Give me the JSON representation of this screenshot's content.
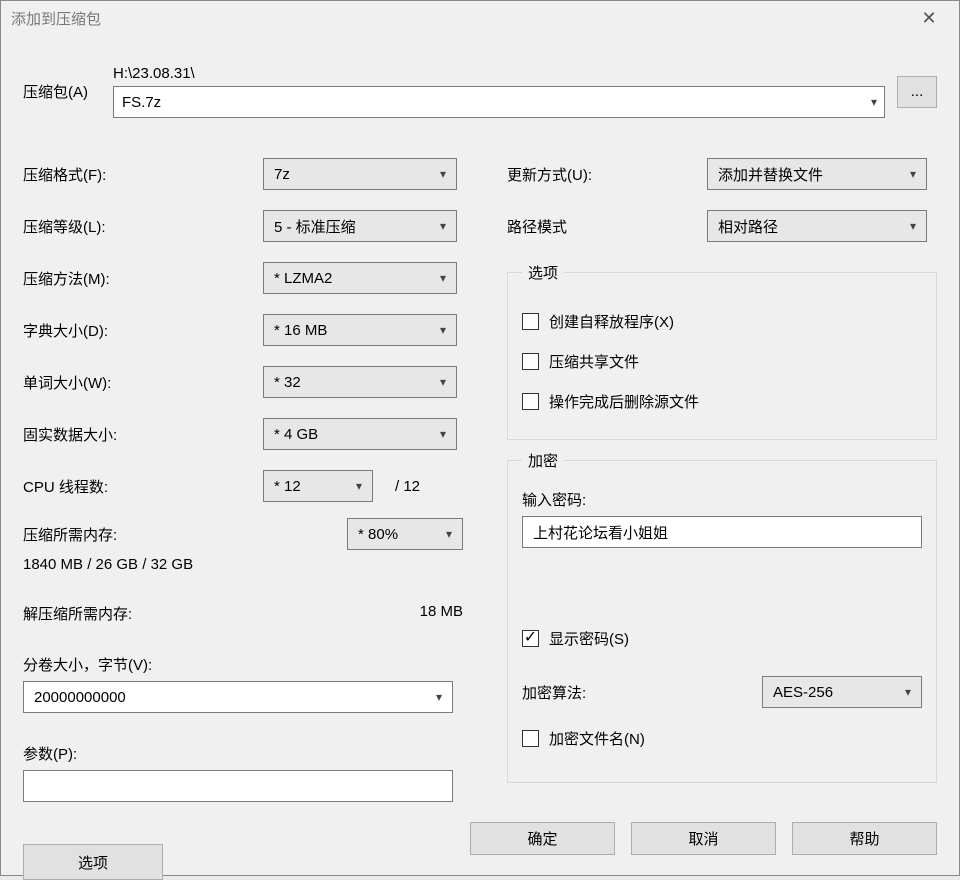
{
  "titlebar": {
    "title": "添加到压缩包"
  },
  "archive": {
    "label": "压缩包(A)",
    "path": "H:\\23.08.31\\",
    "filename": "FS.7z",
    "browse_label": "..."
  },
  "left": {
    "format_label": "压缩格式(F):",
    "format_value": "7z",
    "level_label": "压缩等级(L):",
    "level_value": "5 - 标准压缩",
    "method_label": "压缩方法(M):",
    "method_value": "* LZMA2",
    "dict_label": "字典大小(D):",
    "dict_value": "* 16 MB",
    "word_label": "单词大小(W):",
    "word_value": "* 32",
    "solid_label": "固实数据大小:",
    "solid_value": "* 4 GB",
    "threads_label": "CPU 线程数:",
    "threads_value": "* 12",
    "threads_suffix": "/ 12",
    "compress_mem_label": "压缩所需内存:",
    "compress_mem_value": "1840 MB / 26 GB / 32 GB",
    "mempct_value": "* 80%",
    "decompress_mem_label": "解压缩所需内存:",
    "decompress_mem_value": "18 MB",
    "volume_label": "分卷大小，字节(V):",
    "volume_value": "20000000000",
    "params_label": "参数(P):",
    "params_value": "",
    "options_btn": "选项"
  },
  "right": {
    "update_label": "更新方式(U):",
    "update_value": "添加并替换文件",
    "pathmode_label": "路径模式",
    "pathmode_value": "相对路径",
    "options_legend": "选项",
    "opt_sfx": "创建自释放程序(X)",
    "opt_shared": "压缩共享文件",
    "opt_delete": "操作完成后删除源文件",
    "enc_legend": "加密",
    "pw_label": "输入密码:",
    "pw_value": "上村花论坛看小姐姐",
    "show_pw": "显示密码(S)",
    "enc_alg_label": "加密算法:",
    "enc_alg_value": "AES-256",
    "enc_names": "加密文件名(N)"
  },
  "buttons": {
    "ok": "确定",
    "cancel": "取消",
    "help": "帮助"
  }
}
